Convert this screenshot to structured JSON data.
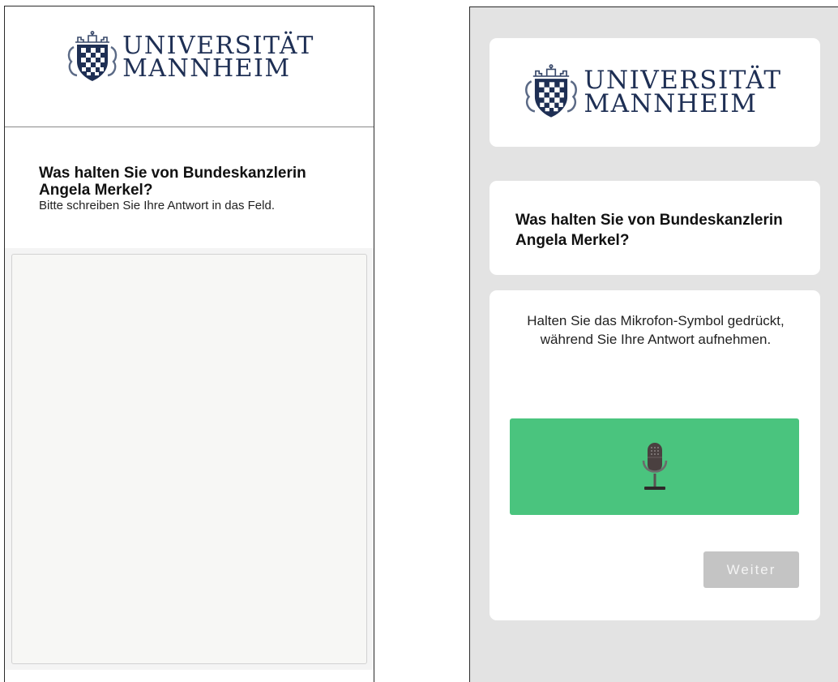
{
  "left_screen": {
    "logo": {
      "line1": "UNIVERSITÄT",
      "line2": "MANNHEIM",
      "icon": "university-crest-icon",
      "color": "#1e2f54"
    },
    "question": {
      "title": "Was halten Sie von Bundeskanzlerin Angela Merkel?",
      "hint": "Bitte schreiben Sie Ihre Antwort in das Feld."
    },
    "answer_field": {
      "value": "",
      "placeholder": ""
    }
  },
  "right_screen": {
    "logo": {
      "line1": "UNIVERSITÄT",
      "line2": "MANNHEIM",
      "icon": "university-crest-icon"
    },
    "question": {
      "title": "Was halten Sie von Bundeskanzlerin Angela Merkel?"
    },
    "instructions": "Halten Sie das Mikrofon-Symbol gedrückt, während Sie Ihre Antwort aufnehmen.",
    "record_button": {
      "icon": "microphone-icon",
      "color": "#4ac47e"
    },
    "next_button": {
      "label": "Weiter",
      "color": "#c4c4c4"
    }
  }
}
